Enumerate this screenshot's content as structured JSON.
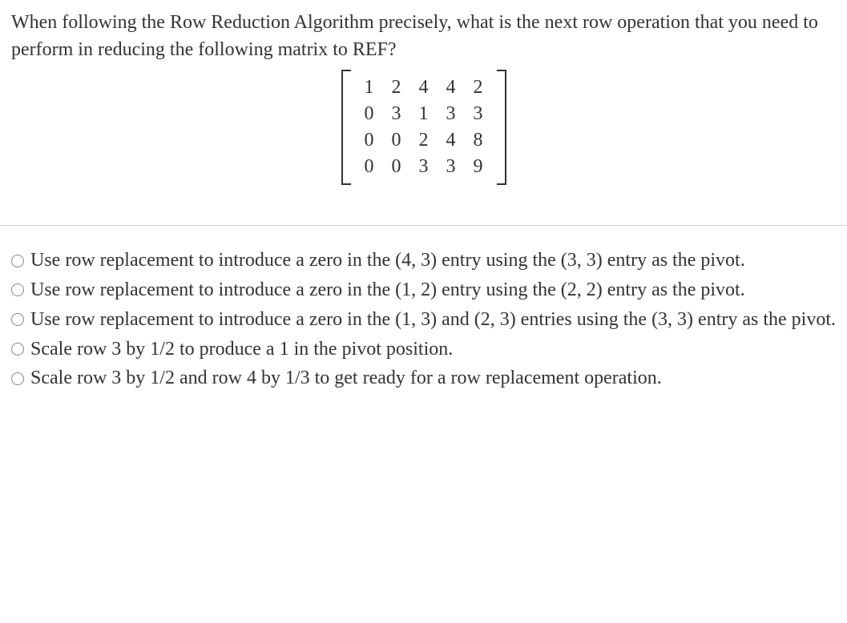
{
  "question": {
    "text": "When following the Row Reduction Algorithm precisely, what is the next row operation that you need to perform in reducing the following matrix to REF?"
  },
  "matrix": {
    "rows": [
      [
        "1",
        "2",
        "4",
        "4",
        "2"
      ],
      [
        "0",
        "3",
        "1",
        "3",
        "3"
      ],
      [
        "0",
        "0",
        "2",
        "4",
        "8"
      ],
      [
        "0",
        "0",
        "3",
        "3",
        "9"
      ]
    ]
  },
  "options": [
    {
      "text": "Use row replacement to introduce a zero in the (4, 3) entry using the (3, 3) entry as the pivot."
    },
    {
      "text": "Use row replacement to introduce a zero in the (1, 2) entry using the (2, 2) entry as the pivot."
    },
    {
      "text": "Use row replacement to introduce a zero in the (1, 3) and (2, 3) entries using the (3, 3) entry as the pivot."
    },
    {
      "text": "Scale row 3 by 1/2 to produce a 1 in the pivot position."
    },
    {
      "text": "Scale row 3 by 1/2 and row 4 by 1/3 to get ready for a row replacement operation."
    }
  ]
}
